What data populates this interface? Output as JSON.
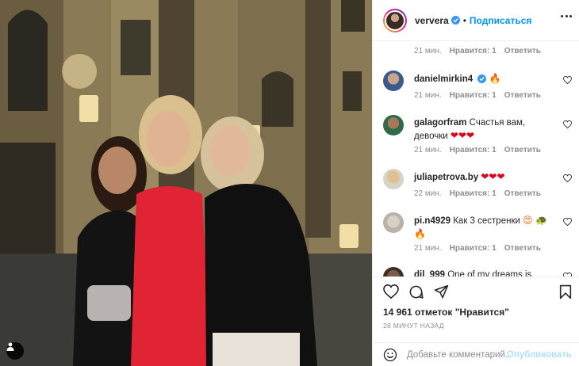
{
  "post": {
    "username": "ververa",
    "follow_label": "Подписаться",
    "likes_text": "14 961 отметок \"Нравится\"",
    "time_ago": "28 МИНУТ НАЗАД",
    "add_comment_placeholder": "Добавьте комментарий...",
    "publish_label": "Опубликовать"
  },
  "comments": {
    "top_meta": {
      "time": "21 мин.",
      "likes": "Нравится: 1",
      "reply": "Ответить"
    },
    "items": [
      {
        "username": "danielmirkin4",
        "verified": true,
        "text": "",
        "emoji": "🔥",
        "time": "21 мин.",
        "likes": "Нравится: 1",
        "reply": "Ответить"
      },
      {
        "username": "galagorfram",
        "text": "Счастья вам, девочки",
        "emoji": "❤❤❤",
        "time": "21 мин.",
        "likes": "Нравится: 1",
        "reply": "Ответить"
      },
      {
        "username": "juliapetrova.by",
        "text": "",
        "emoji": "❤❤❤",
        "time": "22 мин.",
        "likes": "Нравится: 1",
        "reply": "Ответить"
      },
      {
        "username": "pi.n4929",
        "text": "Как 3 сестренки",
        "emoji": "😍 🐢 🔥",
        "time": "21 мин.",
        "likes": "Нравится: 1",
        "reply": "Ответить"
      },
      {
        "username": "dil_999",
        "text": "One of my dreams is",
        "emoji": ""
      }
    ]
  },
  "icons": {
    "more": "more-options-icon",
    "heart": "heart-icon",
    "comment": "comment-icon",
    "share": "share-icon",
    "save": "bookmark-icon",
    "emoji": "emoji-icon",
    "tag": "user-tag-icon"
  },
  "colors": {
    "accent": "#0095f6",
    "muted": "#8e8e8e",
    "text": "#262626",
    "verified": "#3897f0",
    "publish_disabled": "#b2dffc"
  }
}
